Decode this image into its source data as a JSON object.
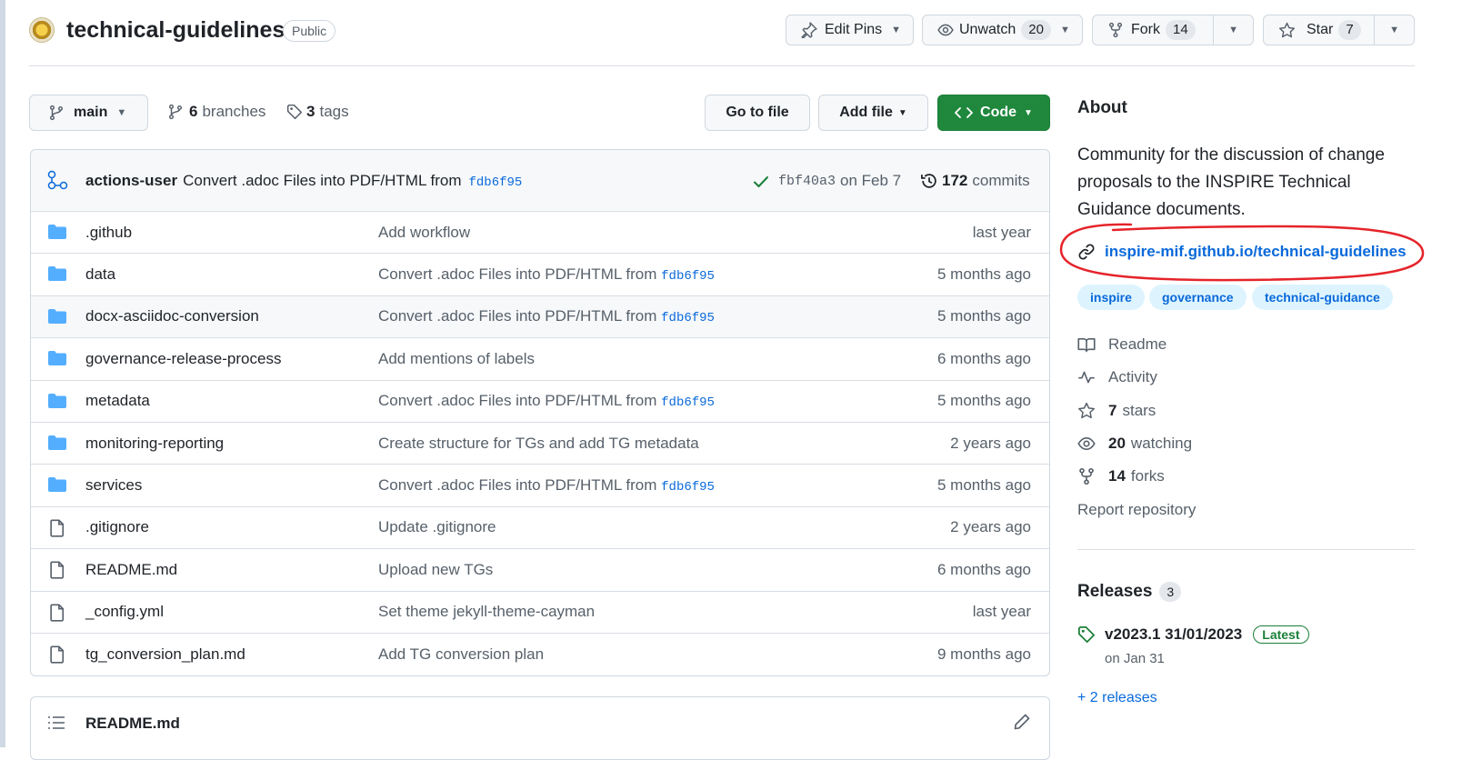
{
  "repo": {
    "name": "technical-guidelines",
    "visibility": "Public"
  },
  "header_actions": {
    "edit_pins_label": "Edit Pins",
    "unwatch_label": "Unwatch",
    "unwatch_count": "20",
    "fork_label": "Fork",
    "fork_count": "14",
    "star_label": "Star",
    "star_count": "7"
  },
  "branch_bar": {
    "branch": "main",
    "branches_count": "6",
    "branches_label": "branches",
    "tags_count": "3",
    "tags_label": "tags",
    "go_to_file": "Go to file",
    "add_file": "Add file",
    "code": "Code"
  },
  "latest_commit": {
    "author": "actions-user",
    "message": "Convert .adoc Files into PDF/HTML from",
    "ref": "fdb6f95",
    "sha": "fbf40a3",
    "date": "on Feb 7",
    "commits_count": "172",
    "commits_label": "commits"
  },
  "files": [
    {
      "type": "dir",
      "name": ".github",
      "message": "Add workflow",
      "ref": "",
      "time": "last year"
    },
    {
      "type": "dir",
      "name": "data",
      "message": "Convert .adoc Files into PDF/HTML from",
      "ref": "fdb6f95",
      "time": "5 months ago"
    },
    {
      "type": "dir",
      "name": "docx-asciidoc-conversion",
      "message": "Convert .adoc Files into PDF/HTML from",
      "ref": "fdb6f95",
      "time": "5 months ago"
    },
    {
      "type": "dir",
      "name": "governance-release-process",
      "message": "Add mentions of labels",
      "ref": "",
      "time": "6 months ago"
    },
    {
      "type": "dir",
      "name": "metadata",
      "message": "Convert .adoc Files into PDF/HTML from",
      "ref": "fdb6f95",
      "time": "5 months ago"
    },
    {
      "type": "dir",
      "name": "monitoring-reporting",
      "message": "Create structure for TGs and add TG metadata",
      "ref": "",
      "time": "2 years ago"
    },
    {
      "type": "dir",
      "name": "services",
      "message": "Convert .adoc Files into PDF/HTML from",
      "ref": "fdb6f95",
      "time": "5 months ago"
    },
    {
      "type": "file",
      "name": ".gitignore",
      "message": "Update .gitignore",
      "ref": "",
      "time": "2 years ago"
    },
    {
      "type": "file",
      "name": "README.md",
      "message": "Upload new TGs",
      "ref": "",
      "time": "6 months ago"
    },
    {
      "type": "file",
      "name": "_config.yml",
      "message": "Set theme jekyll-theme-cayman",
      "ref": "",
      "time": "last year"
    },
    {
      "type": "file",
      "name": "tg_conversion_plan.md",
      "message": "Add TG conversion plan",
      "ref": "",
      "time": "9 months ago"
    }
  ],
  "readme_header": "README.md",
  "about": {
    "heading": "About",
    "description": "Community for the discussion of change proposals to the INSPIRE Technical Guidance documents.",
    "link": "inspire-mif.github.io/technical-guidelines",
    "topics": [
      "inspire",
      "governance",
      "technical-guidance"
    ],
    "readme_label": "Readme",
    "activity_label": "Activity",
    "stars_count": "7",
    "stars_label": "stars",
    "watching_count": "20",
    "watching_label": "watching",
    "forks_count": "14",
    "forks_label": "forks",
    "report_label": "Report repository"
  },
  "releases": {
    "heading": "Releases",
    "count": "3",
    "latest_name": "v2023.1 31/01/2023",
    "latest_badge": "Latest",
    "latest_date": "on Jan 31",
    "more_label": "+ 2 releases"
  },
  "colors": {
    "accent": "#0969da",
    "primary_button": "#1f883d",
    "annotation": "#e5242a",
    "folder": "#54aeff"
  }
}
